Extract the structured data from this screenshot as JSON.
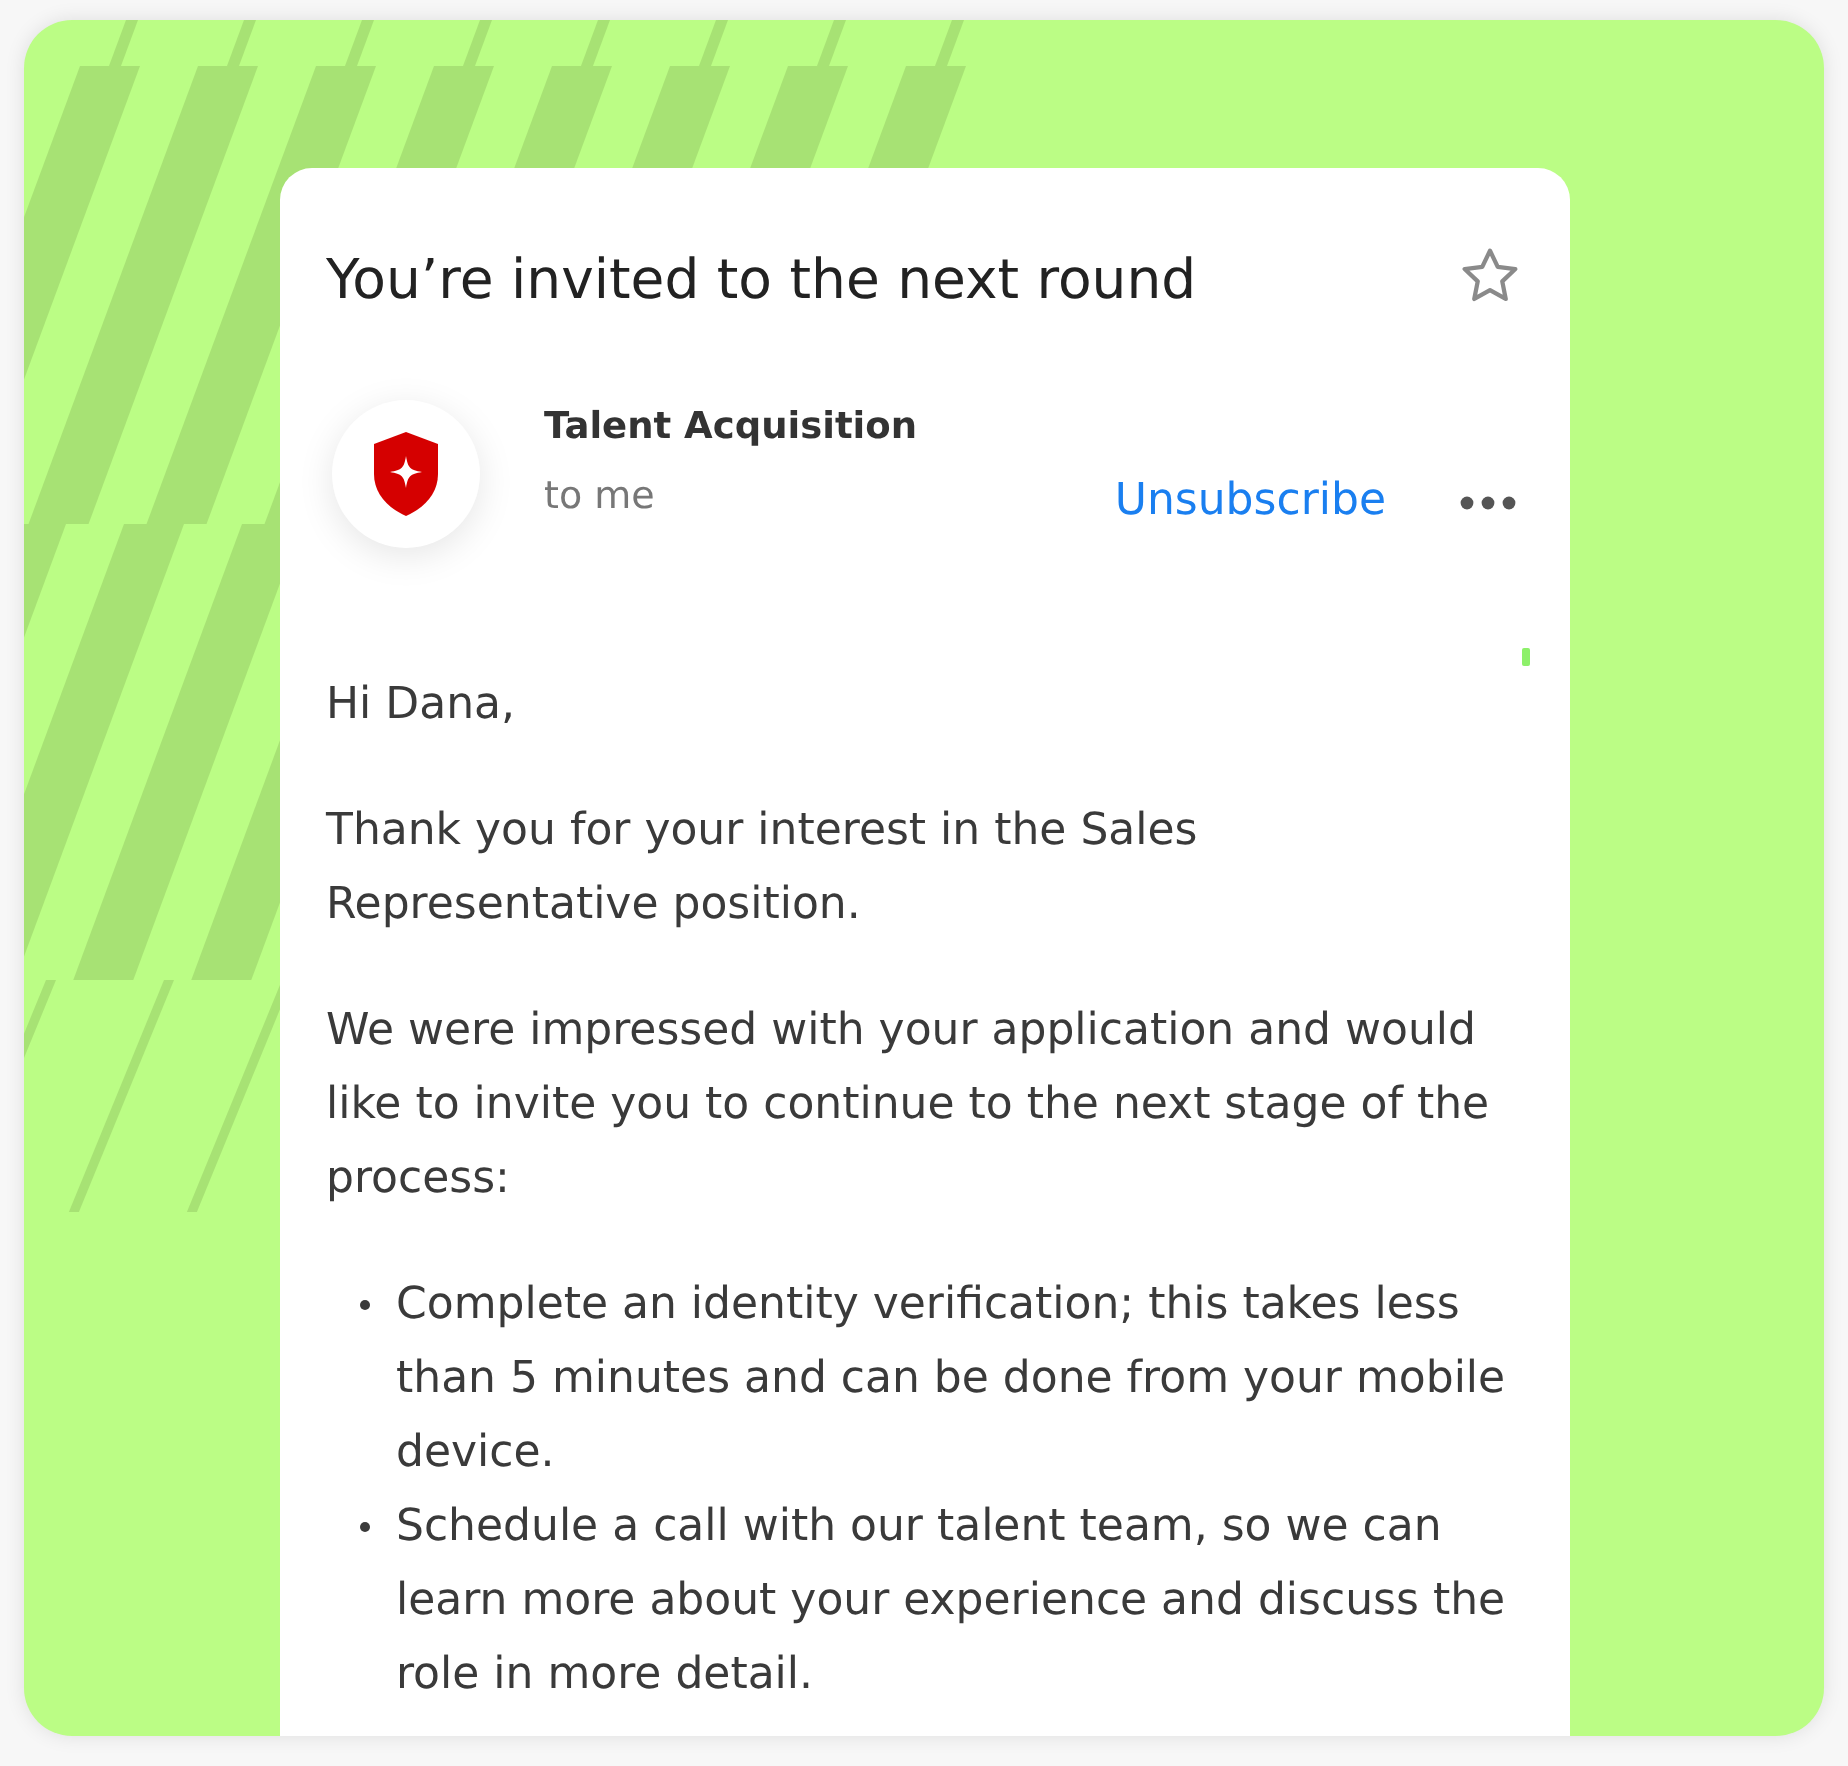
{
  "email": {
    "subject": "You’re invited to the next round",
    "starred": false,
    "sender": {
      "name": "Talent Acquisition",
      "recipient": "to me"
    },
    "unsubscribe": "Unsubscribe",
    "body": {
      "greeting": "Hi Dana,",
      "paragraphs": [
        "Thank you for your interest in the Sales Representative position.",
        "We were impressed with your application and would like to invite you to continue to the next stage of the process:"
      ],
      "bullets": [
        "Complete an identity verification; this takes less than 5 minutes and can be done from your mobile device.",
        "Schedule a call with our talent team, so we can learn more about your experience and discuss the role in more detail."
      ]
    }
  }
}
